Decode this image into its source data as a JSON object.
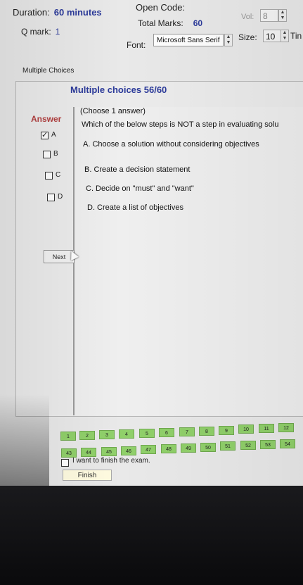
{
  "header": {
    "duration_label": "Duration:",
    "duration_value": "60 minutes",
    "open_code_label": "Open Code:",
    "q_mark_label": "Q mark:",
    "q_mark_value": "1",
    "total_marks_label": "Total Marks:",
    "total_marks_value": "60",
    "vol_label": "Vol:",
    "vol_value": "8",
    "font_label": "Font:",
    "font_value": "Microsoft Sans Serif",
    "size_label": "Size:",
    "size_value": "10",
    "time_label_partial": "Tin"
  },
  "group_label": "Multiple Choices",
  "question": {
    "title": "Multiple choices 56/60",
    "answer_label": "Answer",
    "instruction": "(Choose 1 answer)",
    "text": "Which of the below steps is NOT a step in evaluating solu",
    "options": [
      "A.  Choose a solution without considering objectives",
      "B.  Create a decision statement",
      "C.  Decide on \"must\" and \"want\"",
      "D.  Create a list of objectives"
    ]
  },
  "answer_choices": [
    {
      "label": "A",
      "checked": true
    },
    {
      "label": "B",
      "checked": false
    },
    {
      "label": "C",
      "checked": false
    },
    {
      "label": "D",
      "checked": false
    }
  ],
  "next_label": "Next",
  "question_grid": {
    "row1": [
      "1",
      "2",
      "3",
      "4",
      "5",
      "6",
      "7",
      "8",
      "9",
      "10",
      "11",
      "12"
    ],
    "row2": [
      "43",
      "44",
      "45",
      "46",
      "47",
      "48",
      "49",
      "50",
      "51",
      "52",
      "53",
      "54"
    ]
  },
  "finish_checkbox_label": "I want to finish the exam.",
  "finish_label": "Finish",
  "colors": {
    "accent_blue": "#2b3a9a",
    "answer_red": "#b24040",
    "grid_green": "#90d06a"
  }
}
